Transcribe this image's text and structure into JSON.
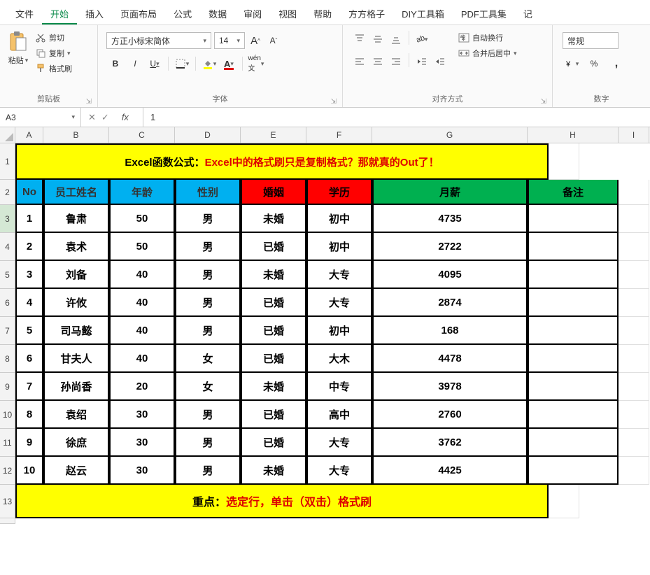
{
  "menu": {
    "items": [
      "文件",
      "开始",
      "插入",
      "页面布局",
      "公式",
      "数据",
      "审阅",
      "视图",
      "帮助",
      "方方格子",
      "DIY工具箱",
      "PDF工具集",
      "记"
    ],
    "active_index": 1
  },
  "ribbon": {
    "clipboard": {
      "label": "剪贴板",
      "paste": "粘贴",
      "cut": "剪切",
      "copy": "复制",
      "format_painter": "格式刷"
    },
    "font": {
      "label": "字体",
      "name": "方正小标宋简体",
      "size": "14",
      "A_big": "A",
      "A_small": "A"
    },
    "align": {
      "label": "对齐方式",
      "wrap": "自动换行",
      "merge": "合并后居中"
    },
    "number": {
      "label": "数字",
      "format": "常规"
    }
  },
  "formula_bar": {
    "name_box": "A3",
    "value": "1"
  },
  "sheet": {
    "columns": [
      "A",
      "B",
      "C",
      "D",
      "E",
      "F",
      "G",
      "H",
      "I"
    ],
    "title_parts": [
      "Excel函数公式：",
      "Excel中的格式刷只是复制格式？那就真的Out了！"
    ],
    "headers": [
      "No",
      "员工姓名",
      "年龄",
      "性别",
      "婚姻",
      "学历",
      "月薪",
      "备注"
    ],
    "rows": [
      {
        "no": "1",
        "name": "鲁肃",
        "age": "50",
        "sex": "男",
        "marry": "未婚",
        "edu": "初中",
        "salary": "4735",
        "note": ""
      },
      {
        "no": "2",
        "name": "袁术",
        "age": "50",
        "sex": "男",
        "marry": "已婚",
        "edu": "初中",
        "salary": "2722",
        "note": ""
      },
      {
        "no": "3",
        "name": "刘备",
        "age": "40",
        "sex": "男",
        "marry": "未婚",
        "edu": "大专",
        "salary": "4095",
        "note": ""
      },
      {
        "no": "4",
        "name": "许攸",
        "age": "40",
        "sex": "男",
        "marry": "已婚",
        "edu": "大专",
        "salary": "2874",
        "note": ""
      },
      {
        "no": "5",
        "name": "司马懿",
        "age": "40",
        "sex": "男",
        "marry": "已婚",
        "edu": "初中",
        "salary": "168",
        "note": ""
      },
      {
        "no": "6",
        "name": "甘夫人",
        "age": "40",
        "sex": "女",
        "marry": "已婚",
        "edu": "大木",
        "salary": "4478",
        "note": ""
      },
      {
        "no": "7",
        "name": "孙尚香",
        "age": "20",
        "sex": "女",
        "marry": "未婚",
        "edu": "中专",
        "salary": "3978",
        "note": ""
      },
      {
        "no": "8",
        "name": "袁绍",
        "age": "30",
        "sex": "男",
        "marry": "已婚",
        "edu": "高中",
        "salary": "2760",
        "note": ""
      },
      {
        "no": "9",
        "name": "徐庶",
        "age": "30",
        "sex": "男",
        "marry": "已婚",
        "edu": "大专",
        "salary": "3762",
        "note": ""
      },
      {
        "no": "10",
        "name": "赵云",
        "age": "30",
        "sex": "男",
        "marry": "未婚",
        "edu": "大专",
        "salary": "4425",
        "note": ""
      }
    ],
    "footer_parts": [
      "重点：",
      "选定行，单击（双击）格式刷"
    ]
  }
}
